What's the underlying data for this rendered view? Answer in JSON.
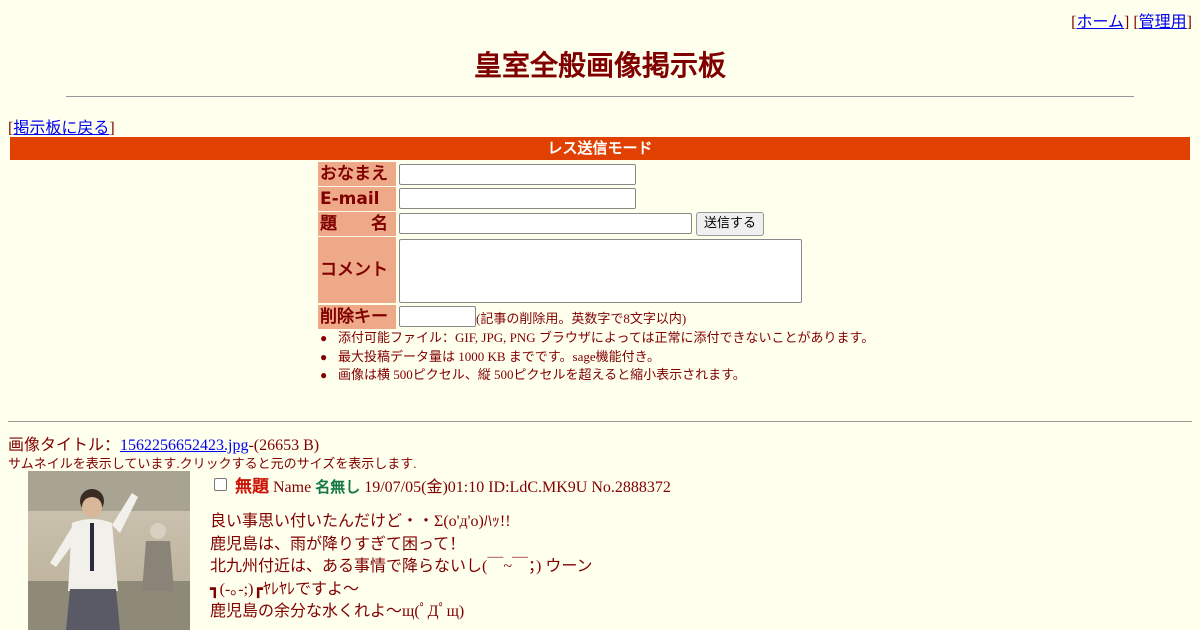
{
  "nav": {
    "open": "[",
    "home": "ホーム",
    "sep": "] [",
    "admin": "管理用",
    "close": "]"
  },
  "board_title": "皇室全般画像掲示板",
  "back": {
    "open": "[",
    "label": "掲示板に戻る",
    "close": "]"
  },
  "mode_label": "レス送信モード",
  "form": {
    "name_label": "おなまえ",
    "email_label": "E-mail",
    "subject_label": "題　　名",
    "submit_label": "送信する",
    "comment_label": "コメント",
    "delkey_label": "削除キー",
    "delkey_note": "(記事の削除用。英数字で8文字以内)"
  },
  "rules": [
    "添付可能ファイル：GIF, JPG, PNG ブラウザによっては正常に添付できないことがあります。",
    "最大投稿データ量は 1000 KB までです。sage機能付き。",
    "画像は横 500ピクセル、縦 500ピクセルを超えると縮小表示されます。"
  ],
  "image": {
    "title_prefix": "画像タイトル：",
    "filename": "1562256652423.jpg",
    "size": "-(26653 B)",
    "thumb_note": "サムネイルを表示しています.クリックすると元のサイズを表示します."
  },
  "post": {
    "subject": "無題",
    "name_prefix": "Name",
    "name": "名無し",
    "meta": "19/07/05(金)01:10 ID:LdC.MK9U No.2888372",
    "lines": [
      "良い事思い付いたんだけど・・Σ(o'д'o)ﾊｯ!!",
      "鹿児島は、雨が降りすぎて困って！",
      "北九州付近は、ある事情で降らないし(￣~￣；) ウーン",
      "┓(-｡-;)┏ﾔﾚﾔﾚですよ～",
      "鹿児島の余分な水くれよ～щ(ﾟДﾟщ)"
    ]
  },
  "colors": {
    "background": "#ffffee",
    "text": "#800000",
    "mode_bar": "#e04000",
    "label_bg": "#eeaa88",
    "subject": "#cc1105",
    "name": "#117743"
  }
}
